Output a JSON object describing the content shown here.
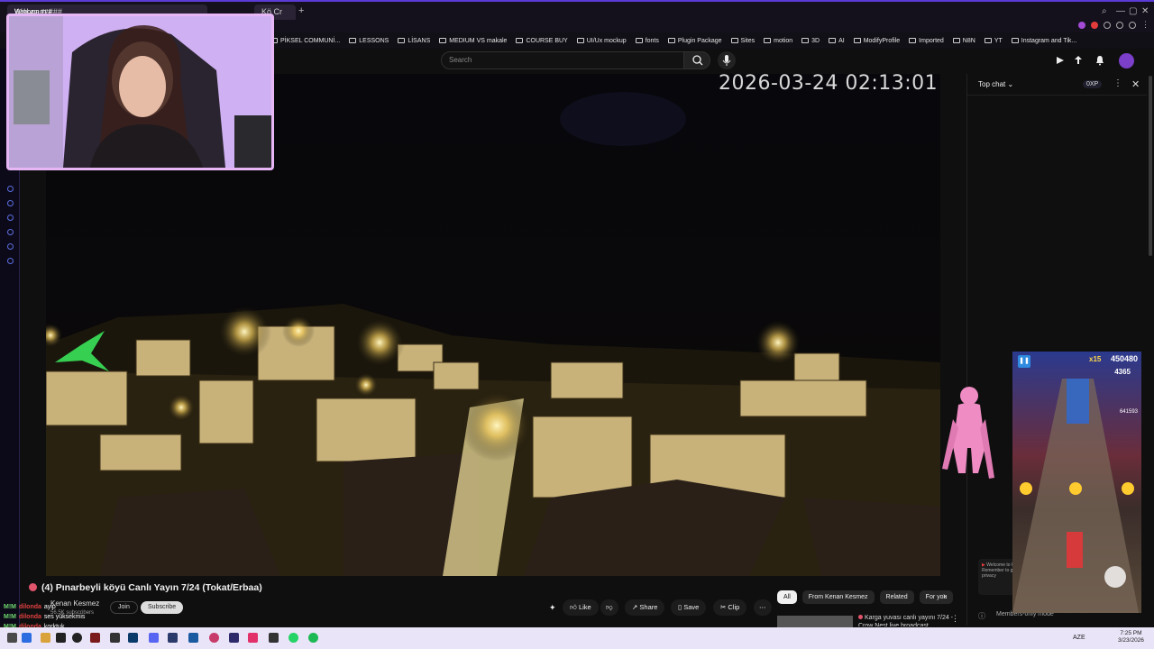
{
  "browser": {
    "tab1_title": "Webcam ###",
    "tab2_title": "Kö Cr",
    "new_tab": "+",
    "bookmarks": [
      "PİKSEL COMMUNİ...",
      "LESSONS",
      "LİSANS",
      "MEDIUM VS makale",
      "COURSE BUY",
      "UI/Ux mockup",
      "fonts",
      "Plugin Package",
      "Sites",
      "motion",
      "3D",
      "AI",
      "ModifyProfile",
      "Imported",
      "N8N",
      "YT",
      "Instagram and Tik..."
    ]
  },
  "header": {
    "search_placeholder": "Search",
    "icons": [
      "create-icon",
      "upload-icon",
      "bell-icon"
    ]
  },
  "video": {
    "timestamp": "2026-03-24 02:13:01",
    "title": "(4) Pınarbeyli köyü Canlı Yayın 7/24 (Tokat/Erbaa)",
    "channel": "Kenan Kesmez",
    "subscribers": "56.5K subscribers",
    "join_label": "Join",
    "subscribe_label": "Subscribe",
    "actions": {
      "like": "Like",
      "share": "Share",
      "save": "Save",
      "clip": "Clip",
      "more": "⋯"
    }
  },
  "chips": [
    "All",
    "From Kenan Kesmez",
    "Related",
    "For you"
  ],
  "related": {
    "title": "Karga yuvası canlı yayını 7/24 - Crow Nest live broadcast"
  },
  "chat": {
    "title": "Top chat",
    "xp": "0XP",
    "members": "Members-only mode",
    "promo": "Welcome to live chat! Remember to guard your privacy"
  },
  "game": {
    "score": "450480",
    "coins": "4365",
    "multiplier": "x15",
    "third": "641593"
  },
  "stream_chat": [
    {
      "badge": "M!M",
      "user": "dilonda",
      "text": "ayip"
    },
    {
      "badge": "M!M",
      "user": "dilonda",
      "text": "ses yüksekmis"
    },
    {
      "badge": "M!M",
      "user": "dilonda",
      "text": "korktuk"
    }
  ],
  "taskbar": {
    "tray_lang": "AZE",
    "time": "7:25 PM",
    "date": "3/23/2026"
  },
  "colors": {
    "accent_purple": "#5b3bd6",
    "live_dot": "#e2546c",
    "webcam_border": "#e6b6f5"
  }
}
